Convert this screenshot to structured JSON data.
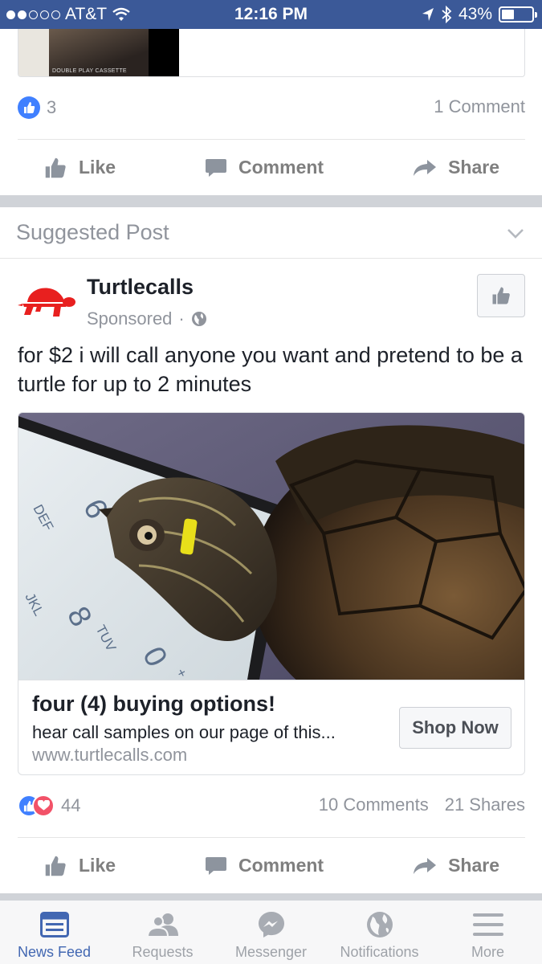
{
  "status_bar": {
    "carrier": "AT&T",
    "time": "12:16 PM",
    "battery": "43%",
    "battery_level": 0.43
  },
  "prev_post": {
    "thumb_caption": "DOUBLE PLAY CASSETTE",
    "like_count": "3",
    "comments": "1 Comment",
    "actions": {
      "like": "Like",
      "comment": "Comment",
      "share": "Share"
    }
  },
  "suggested": {
    "header": "Suggested Post"
  },
  "post": {
    "page_name": "Turtlecalls",
    "sponsored": "Sponsored",
    "separator": "·",
    "text": "for $2 i will call anyone you want and pretend to be a turtle for up to 2 minutes",
    "keypad_labels": [
      "DEF",
      "6",
      "JKL",
      "8",
      "TUV",
      "0",
      "+"
    ],
    "ad": {
      "title": "four (4) buying options!",
      "description": "hear call samples on our page of this...",
      "url": "www.turtlecalls.com",
      "cta": "Shop Now"
    },
    "reaction_count": "44",
    "comments": "10 Comments",
    "shares": "21 Shares",
    "actions": {
      "like": "Like",
      "comment": "Comment",
      "share": "Share"
    }
  },
  "tabs": [
    {
      "label": "News Feed",
      "icon": "news-feed-icon",
      "active": true
    },
    {
      "label": "Requests",
      "icon": "friend-requests-icon",
      "active": false
    },
    {
      "label": "Messenger",
      "icon": "messenger-icon",
      "active": false
    },
    {
      "label": "Notifications",
      "icon": "globe-icon",
      "active": false
    },
    {
      "label": "More",
      "icon": "menu-icon",
      "active": false
    }
  ],
  "colors": {
    "brand_blue": "#3b5998",
    "active_tab": "#4267b2",
    "like_blue": "#4080ff",
    "love_red": "#f25268",
    "turtle_red": "#e8201f"
  }
}
